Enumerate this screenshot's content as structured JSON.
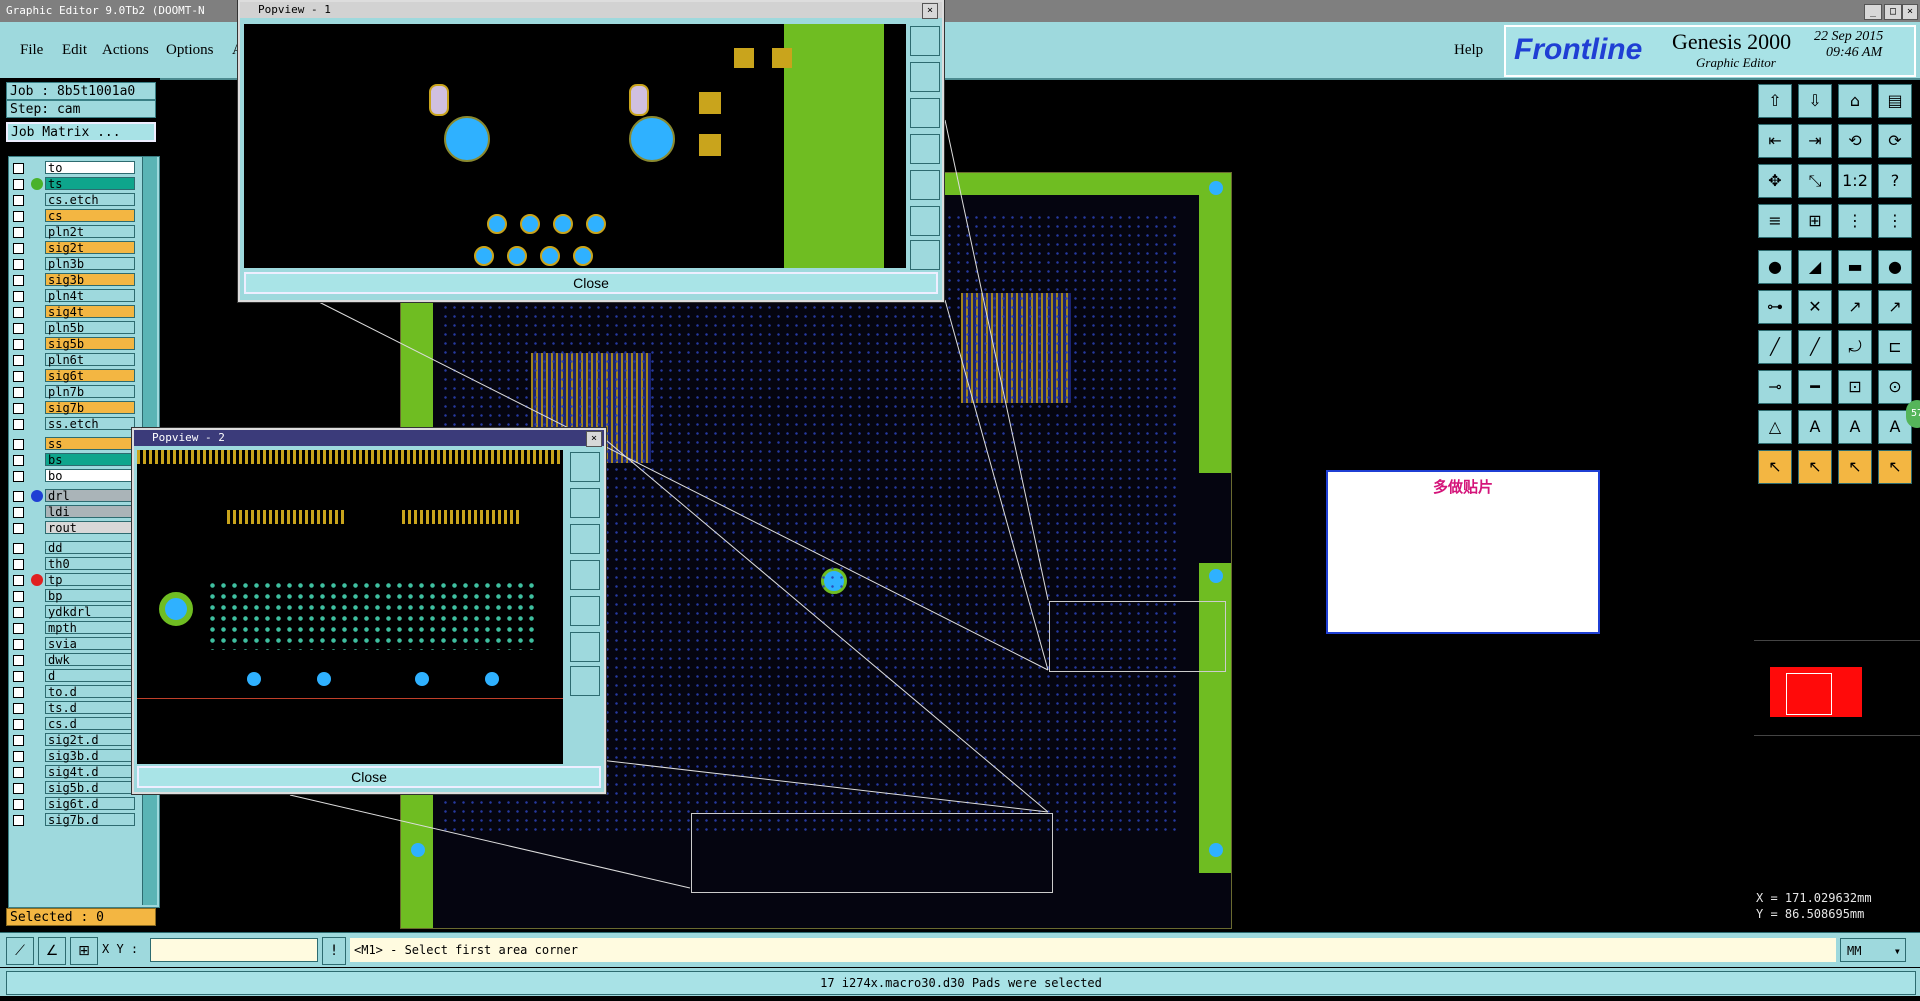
{
  "app": {
    "title": "Graphic Editor 9.0Tb2  (DOOMT-N",
    "product": "Genesis 2000",
    "product_sub": "Graphic Editor",
    "vendor": "Frontline",
    "date": "22 Sep 2015",
    "time": "09:46 AM"
  },
  "menu": {
    "file": "File",
    "edit": "Edit",
    "actions": "Actions",
    "options": "Options",
    "a": "A",
    "help": "Help"
  },
  "job": {
    "job_label": "Job : 8b5t1001a0",
    "step_label": "Step: cam",
    "matrix_button": "Job Matrix ..."
  },
  "layers": [
    {
      "name": "to",
      "color": "#ffffff",
      "dot": ""
    },
    {
      "name": "ts",
      "color": "#0ea58c",
      "dot": "#4ab22a"
    },
    {
      "name": "cs.etch",
      "color": "#9ed9dd",
      "dot": ""
    },
    {
      "name": "cs",
      "color": "#f3b642",
      "dot": ""
    },
    {
      "name": "pln2t",
      "color": "#9ed9dd",
      "dot": ""
    },
    {
      "name": "sig2t",
      "color": "#f3b642",
      "dot": ""
    },
    {
      "name": "pln3b",
      "color": "#9ed9dd",
      "dot": ""
    },
    {
      "name": "sig3b",
      "color": "#f3b642",
      "dot": ""
    },
    {
      "name": "pln4t",
      "color": "#9ed9dd",
      "dot": ""
    },
    {
      "name": "sig4t",
      "color": "#f3b642",
      "dot": ""
    },
    {
      "name": "pln5b",
      "color": "#9ed9dd",
      "dot": ""
    },
    {
      "name": "sig5b",
      "color": "#f3b642",
      "dot": ""
    },
    {
      "name": "pln6t",
      "color": "#9ed9dd",
      "dot": ""
    },
    {
      "name": "sig6t",
      "color": "#f3b642",
      "dot": ""
    },
    {
      "name": "pln7b",
      "color": "#9ed9dd",
      "dot": ""
    },
    {
      "name": "sig7b",
      "color": "#f3b642",
      "dot": ""
    },
    {
      "name": "ss.etch",
      "color": "#9ed9dd",
      "dot": ""
    },
    {
      "name": "ss",
      "color": "#f3b642",
      "dot": ""
    },
    {
      "name": "bs",
      "color": "#0ea58c",
      "dot": ""
    },
    {
      "name": "bo",
      "color": "#ffffff",
      "dot": ""
    },
    {
      "name": "drl",
      "color": "#aab4b8",
      "dot": "#1f3fd4"
    },
    {
      "name": "ldi",
      "color": "#aab4b8",
      "dot": ""
    },
    {
      "name": "rout",
      "color": "#d8d8d8",
      "dot": ""
    },
    {
      "name": "dd",
      "color": "#9ed9dd",
      "dot": ""
    },
    {
      "name": "th0",
      "color": "#9ed9dd",
      "dot": ""
    },
    {
      "name": "tp",
      "color": "#9ed9dd",
      "dot": "#e02020"
    },
    {
      "name": "bp",
      "color": "#9ed9dd",
      "dot": ""
    },
    {
      "name": "ydkdrl",
      "color": "#9ed9dd",
      "dot": ""
    },
    {
      "name": "mpth",
      "color": "#9ed9dd",
      "dot": ""
    },
    {
      "name": "svia",
      "color": "#9ed9dd",
      "dot": ""
    },
    {
      "name": "dwk",
      "color": "#9ed9dd",
      "dot": ""
    },
    {
      "name": "d",
      "color": "#9ed9dd",
      "dot": ""
    },
    {
      "name": "to.d",
      "color": "#9ed9dd",
      "dot": ""
    },
    {
      "name": "ts.d",
      "color": "#9ed9dd",
      "dot": ""
    },
    {
      "name": "cs.d",
      "color": "#9ed9dd",
      "dot": ""
    },
    {
      "name": "sig2t.d",
      "color": "#9ed9dd",
      "dot": ""
    },
    {
      "name": "sig3b.d",
      "color": "#9ed9dd",
      "dot": ""
    },
    {
      "name": "sig4t.d",
      "color": "#9ed9dd",
      "dot": ""
    },
    {
      "name": "sig5b.d",
      "color": "#9ed9dd",
      "dot": ""
    },
    {
      "name": "sig6t.d",
      "color": "#9ed9dd",
      "dot": ""
    },
    {
      "name": "sig7b.d",
      "color": "#9ed9dd",
      "dot": ""
    }
  ],
  "selected_label": "Selected : 0",
  "popview1": {
    "title": "Popview - 1",
    "close": "Close"
  },
  "popview2": {
    "title": "Popview - 2",
    "close": "Close"
  },
  "note_text": "多做贴片",
  "coords": {
    "x": "X = 171.029632mm",
    "y": "Y =  86.508695mm"
  },
  "cmd": {
    "xy_label": "X Y :",
    "xy_value": "",
    "prompt": "<M1> - Select first area corner",
    "units": "MM"
  },
  "status": "17 i274x.macro30.d30 Pads were selected",
  "badge": "57",
  "colors": {
    "panel": "#9ed9dd",
    "board_green": "#6fbd22",
    "via_blue": "#2fb1ff",
    "pad_gold": "#c9a41c"
  }
}
